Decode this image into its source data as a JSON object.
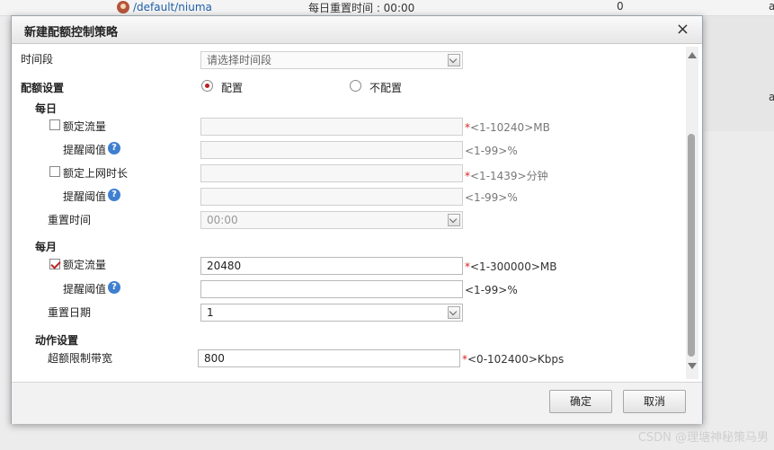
{
  "background": {
    "user_path": "/default/niuma",
    "reset_time": "每日重置时间 : 00:00",
    "count": "0",
    "side_letter": "a",
    "side_letter_top": "a"
  },
  "dialog": {
    "title": "新建配额控制策略",
    "close_symbol": "×"
  },
  "form": {
    "time_period_label": "时间段",
    "time_period_placeholder": "请选择时间段",
    "quota_settings_label": "配额设置",
    "radio_configure": "配置",
    "radio_not_configure": "不配置",
    "daily": {
      "section_label": "每日",
      "quota_traffic_label": "额定流量",
      "quota_traffic_value": "",
      "quota_traffic_hint_req": "*",
      "quota_traffic_hint": "<1-10240>MB",
      "alert_threshold_label": "提醒阈值",
      "alert_threshold_hint": "<1-99>%",
      "quota_online_label": "额定上网时长",
      "quota_online_hint_req": "*",
      "quota_online_hint": "<1-1439>分钟",
      "alert_threshold2_label": "提醒阈值",
      "alert_threshold2_hint": "<1-99>%",
      "reset_time_label": "重置时间",
      "reset_time_value": "00:00"
    },
    "monthly": {
      "section_label": "每月",
      "quota_traffic_label": "额定流量",
      "quota_traffic_value": "20480",
      "quota_traffic_hint_req": "*",
      "quota_traffic_hint": "<1-300000>MB",
      "alert_threshold_label": "提醒阈值",
      "alert_threshold_hint": "<1-99>%",
      "reset_date_label": "重置日期",
      "reset_date_value": "1"
    },
    "action": {
      "section_label": "动作设置",
      "limit_bw_label": "超额限制带宽",
      "limit_bw_value": "800",
      "limit_bw_hint_req": "*",
      "limit_bw_hint": "<0-102400>Kbps"
    }
  },
  "buttons": {
    "ok": "确定",
    "cancel": "取消"
  },
  "help_symbol": "?",
  "watermark": "CSDN @理塘神秘策马男",
  "colors": {
    "accent_red": "#b22222",
    "link_blue": "#1f5fa8",
    "help_blue": "#3f7fd0"
  }
}
